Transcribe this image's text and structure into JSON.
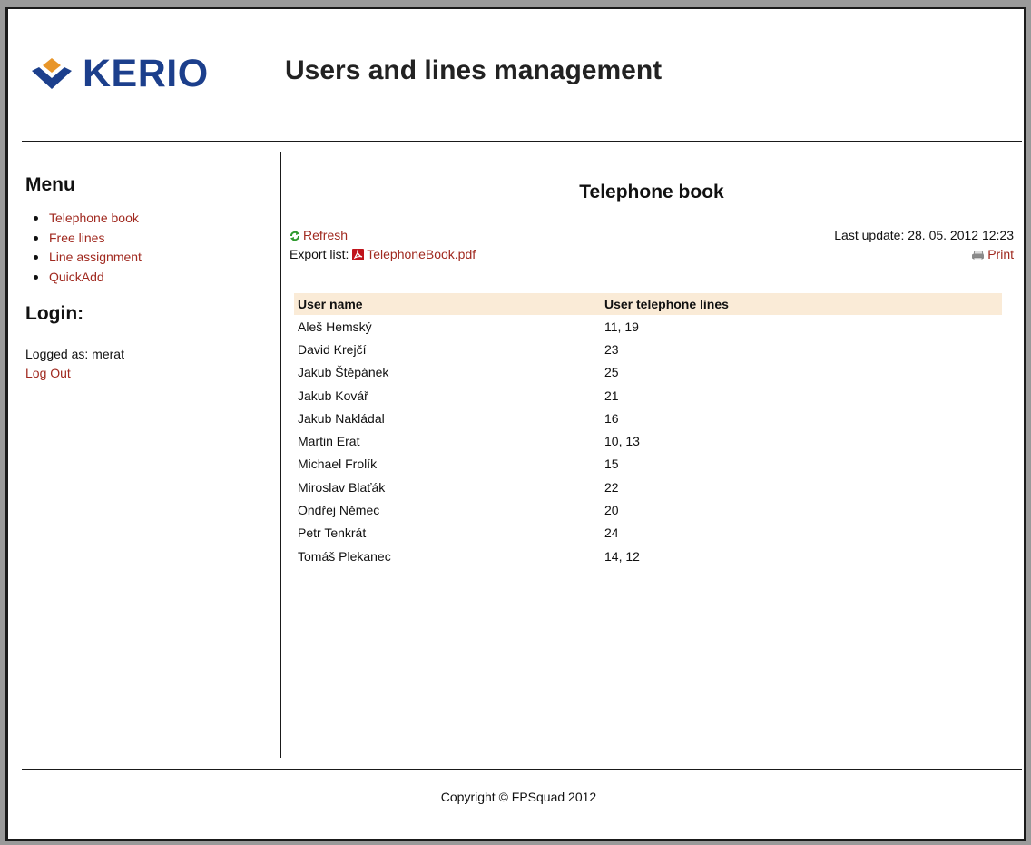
{
  "header": {
    "logo_text": "KERIO",
    "app_title": "Users and lines management"
  },
  "sidebar": {
    "menu_heading": "Menu",
    "menu_items": [
      {
        "label": "Telephone book"
      },
      {
        "label": "Free lines"
      },
      {
        "label": "Line assignment"
      },
      {
        "label": "QuickAdd"
      }
    ],
    "login_heading": "Login:",
    "logged_as": "Logged as: merat",
    "logout_label": "Log Out"
  },
  "main": {
    "title": "Telephone book",
    "refresh_label": "Refresh",
    "export_label": "Export list:",
    "export_file": "TelephoneBook.pdf",
    "last_update": "Last update: 28. 05. 2012 12:23",
    "print_label": "Print",
    "table": {
      "headers": [
        "User name",
        "User telephone lines"
      ],
      "rows": [
        [
          "Aleš Hemský",
          "11, 19"
        ],
        [
          "David Krejčí",
          "23"
        ],
        [
          "Jakub Štěpánek",
          "25"
        ],
        [
          "Jakub Kovář",
          "21"
        ],
        [
          "Jakub Nakládal",
          "16"
        ],
        [
          "Martin Erat",
          "10, 13"
        ],
        [
          "Michael Frolík",
          "15"
        ],
        [
          "Miroslav Blaťák",
          "22"
        ],
        [
          "Ondřej Němec",
          "20"
        ],
        [
          "Petr Tenkrát",
          "24"
        ],
        [
          "Tomáš Plekanec",
          "14, 12"
        ]
      ]
    }
  },
  "footer": {
    "copyright": "Copyright © FPSquad 2012"
  },
  "colors": {
    "link": "#a0291f",
    "logo_blue": "#1c3f8c",
    "logo_orange": "#e8962a",
    "table_header_bg": "#faebd7",
    "outer_bg": "#9a9a9a"
  },
  "icons": {
    "logo": "kerio-chevron-icon",
    "refresh": "refresh-icon",
    "pdf": "pdf-icon",
    "print": "print-icon"
  }
}
